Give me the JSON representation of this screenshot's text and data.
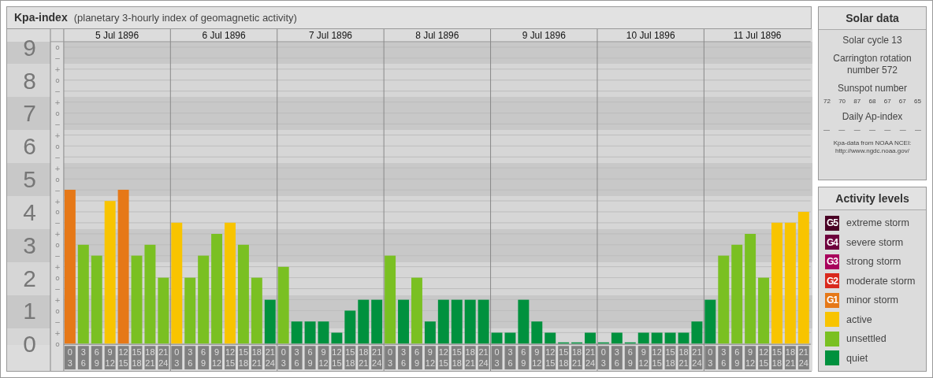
{
  "title": {
    "name": "Kpa-index",
    "subtitle": "(planetary 3-hourly index of geomagnetic activity)"
  },
  "chart": {
    "chart_data": {
      "type": "bar",
      "ylim": [
        0,
        9.17
      ],
      "grid": true,
      "yticks": [
        {
          "value": 9,
          "label": "9"
        },
        {
          "value": 8,
          "label": "8"
        },
        {
          "value": 7,
          "label": "7"
        },
        {
          "value": 6,
          "label": "6"
        },
        {
          "value": 5,
          "label": "5"
        },
        {
          "value": 4,
          "label": "4"
        },
        {
          "value": 3,
          "label": "3"
        },
        {
          "value": 2,
          "label": "2"
        },
        {
          "value": 1,
          "label": "1"
        },
        {
          "value": 0,
          "label": "0"
        }
      ],
      "series": [
        {
          "values": [
            4.67,
            3,
            2.67,
            4.33,
            4.67,
            2.67,
            3,
            2,
            3.67,
            2,
            2.67,
            3.33,
            3.67,
            3,
            2,
            1.33,
            2.33,
            0.67,
            0.67,
            0.67,
            0.33,
            1,
            1.33,
            1.33,
            2.67,
            1.33,
            2,
            0.67,
            1.33,
            1.33,
            1.33,
            1.33,
            0.33,
            0.33,
            1.33,
            0.67,
            0.33,
            0,
            0,
            0.33,
            0,
            0.33,
            0,
            0.33,
            0.33,
            0.33,
            0.33,
            0.67,
            1.33,
            2.67,
            3,
            3.33,
            2,
            3.67,
            3.67,
            4
          ]
        }
      ]
    },
    "minor_ticks": [
      "o",
      "−",
      "+",
      "o",
      "−",
      "+",
      "o",
      "−",
      "+",
      "o",
      "−",
      "+",
      "o",
      "−",
      "+",
      "o",
      "−",
      "+",
      "o",
      "−",
      "+",
      "o",
      "−",
      "+",
      "o",
      "−",
      "+",
      "o"
    ],
    "days": [
      {
        "date": "5 Jul 1896",
        "slots": [
          [
            "0",
            "3"
          ],
          [
            "3",
            "6"
          ],
          [
            "6",
            "9"
          ],
          [
            "9",
            "12"
          ],
          [
            "12",
            "15"
          ],
          [
            "15",
            "18"
          ],
          [
            "18",
            "21"
          ],
          [
            "21",
            "24"
          ]
        ]
      },
      {
        "date": "6 Jul 1896",
        "slots": [
          [
            "0",
            "3"
          ],
          [
            "3",
            "6"
          ],
          [
            "6",
            "9"
          ],
          [
            "9",
            "12"
          ],
          [
            "12",
            "15"
          ],
          [
            "15",
            "18"
          ],
          [
            "18",
            "21"
          ],
          [
            "21",
            "24"
          ]
        ]
      },
      {
        "date": "7 Jul 1896",
        "slots": [
          [
            "0",
            "3"
          ],
          [
            "3",
            "6"
          ],
          [
            "6",
            "9"
          ],
          [
            "9",
            "12"
          ],
          [
            "12",
            "15"
          ],
          [
            "15",
            "18"
          ],
          [
            "18",
            "21"
          ],
          [
            "21",
            "24"
          ]
        ]
      },
      {
        "date": "8 Jul 1896",
        "slots": [
          [
            "0",
            "3"
          ],
          [
            "3",
            "6"
          ],
          [
            "6",
            "9"
          ],
          [
            "9",
            "12"
          ],
          [
            "12",
            "15"
          ],
          [
            "15",
            "18"
          ],
          [
            "18",
            "21"
          ],
          [
            "21",
            "24"
          ]
        ]
      },
      {
        "date": "9 Jul 1896",
        "slots": [
          [
            "0",
            "3"
          ],
          [
            "3",
            "6"
          ],
          [
            "6",
            "9"
          ],
          [
            "9",
            "12"
          ],
          [
            "12",
            "15"
          ],
          [
            "15",
            "18"
          ],
          [
            "18",
            "21"
          ],
          [
            "21",
            "24"
          ]
        ]
      },
      {
        "date": "10 Jul 1896",
        "slots": [
          [
            "0",
            "3"
          ],
          [
            "3",
            "6"
          ],
          [
            "6",
            "9"
          ],
          [
            "9",
            "12"
          ],
          [
            "12",
            "15"
          ],
          [
            "15",
            "18"
          ],
          [
            "18",
            "21"
          ],
          [
            "21",
            "24"
          ]
        ]
      },
      {
        "date": "11 Jul 1896",
        "slots": [
          [
            "0",
            "3"
          ],
          [
            "3",
            "6"
          ],
          [
            "6",
            "9"
          ],
          [
            "9",
            "12"
          ],
          [
            "12",
            "15"
          ],
          [
            "15",
            "18"
          ],
          [
            "18",
            "21"
          ],
          [
            "21",
            "24"
          ]
        ]
      }
    ]
  },
  "solar_data": {
    "title": "Solar data",
    "solar_cycle": "Solar cycle 13",
    "carrington": "Carrington rotation number 572",
    "sunspot_heading": "Sunspot number",
    "sunspots": [
      "72",
      "70",
      "87",
      "68",
      "67",
      "67",
      "65"
    ],
    "ap_heading": "Daily Ap-index",
    "ap_values": [
      "—",
      "—",
      "—",
      "—",
      "—",
      "—",
      "—"
    ],
    "source": "Kpa-data from NOAA NCEI:",
    "source_url": "http://www.ngdc.noaa.gov/"
  },
  "activity_levels": {
    "title": "Activity levels",
    "items": [
      {
        "badge": "G5",
        "label": "extreme storm",
        "color": "#4a0024"
      },
      {
        "badge": "G4",
        "label": "severe storm",
        "color": "#6e003c"
      },
      {
        "badge": "G3",
        "label": "strong storm",
        "color": "#a8005c"
      },
      {
        "badge": "G2",
        "label": "moderate storm",
        "color": "#d9291c"
      },
      {
        "badge": "G1",
        "label": "minor storm",
        "color": "#e67817"
      },
      {
        "label": "active",
        "color": "#f8c400"
      },
      {
        "label": "unsettled",
        "color": "#7ac022"
      },
      {
        "label": "quiet",
        "color": "#00913e"
      }
    ]
  }
}
